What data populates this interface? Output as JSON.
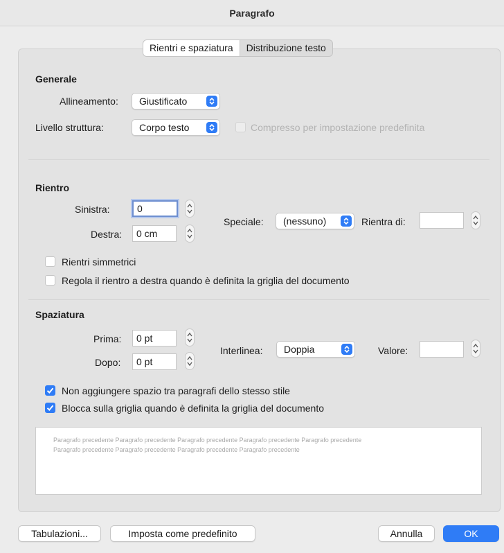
{
  "window": {
    "title": "Paragrafo"
  },
  "tabs": [
    {
      "label": "Rientri e spaziatura",
      "active": true
    },
    {
      "label": "Distribuzione testo",
      "active": false
    }
  ],
  "generale": {
    "title": "Generale",
    "allineamento_label": "Allineamento:",
    "allineamento_value": "Giustificato",
    "livello_label": "Livello struttura:",
    "livello_value": "Corpo testo",
    "compresso_label": "Compresso per impostazione predefinita",
    "compresso_checked": false,
    "compresso_enabled": false
  },
  "rientro": {
    "title": "Rientro",
    "sinistra_label": "Sinistra:",
    "sinistra_value": "0",
    "destra_label": "Destra:",
    "destra_value": "0 cm",
    "speciale_label": "Speciale:",
    "speciale_value": "(nessuno)",
    "rientra_label": "Rientra di:",
    "rientra_value": "",
    "simmetrici_label": "Rientri simmetrici",
    "simmetrici_checked": false,
    "regola_label": "Regola il rientro a destra quando è definita la griglia del documento",
    "regola_checked": false
  },
  "spaziatura": {
    "title": "Spaziatura",
    "prima_label": "Prima:",
    "prima_value": "0 pt",
    "dopo_label": "Dopo:",
    "dopo_value": "0 pt",
    "interlinea_label": "Interlinea:",
    "interlinea_value": "Doppia",
    "valore_label": "Valore:",
    "valore_value": "",
    "non_aggiungere_label": "Non aggiungere spazio tra paragrafi dello stesso stile",
    "non_aggiungere_checked": true,
    "blocca_label": "Blocca sulla griglia quando è definita la griglia del documento",
    "blocca_checked": true
  },
  "preview": {
    "line1": "Paragrafo precedente Paragrafo precedente Paragrafo precedente Paragrafo precedente Paragrafo precedente",
    "line2": "Paragrafo precedente Paragrafo precedente Paragrafo precedente Paragrafo precedente"
  },
  "buttons": {
    "tabulazioni": "Tabulazioni...",
    "predefinito": "Imposta come predefinito",
    "annulla": "Annulla",
    "ok": "OK"
  },
  "colors": {
    "accent": "#2f7cf6",
    "panel": "#e3e3e3",
    "window": "#ececec"
  },
  "icons": {
    "popup": "chevron-updown-icon",
    "stepper": "stepper-arrows-icon",
    "check": "checkmark-icon"
  }
}
